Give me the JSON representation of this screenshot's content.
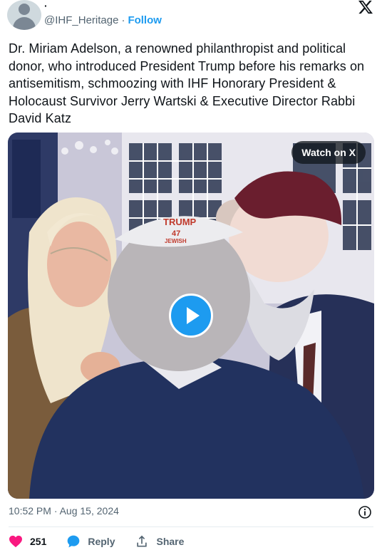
{
  "header": {
    "display_name": "·",
    "handle": "@IHF_Heritage",
    "separator": "·",
    "follow_label": "Follow"
  },
  "tweet": {
    "text": "Dr. Miriam Adelson, a renowned philanthropist and political donor, who introduced President Trump before his remarks on antisemitism, schmoozing with IHF Honorary President & Holocaust Survivor Jerry Wartski & Executive Director Rabbi David Katz",
    "timestamp": "10:52 PM · Aug 15, 2024"
  },
  "media": {
    "watch_label": "Watch on X",
    "kippah_text_line1": "TRUMP",
    "kippah_text_line2": "47",
    "kippah_text_line3": "JEWISH"
  },
  "actions": {
    "like_count": "251",
    "reply_label": "Reply",
    "share_label": "Share"
  },
  "colors": {
    "accent": "#1d9bf0",
    "like": "#f91880",
    "text_secondary": "#536471"
  }
}
